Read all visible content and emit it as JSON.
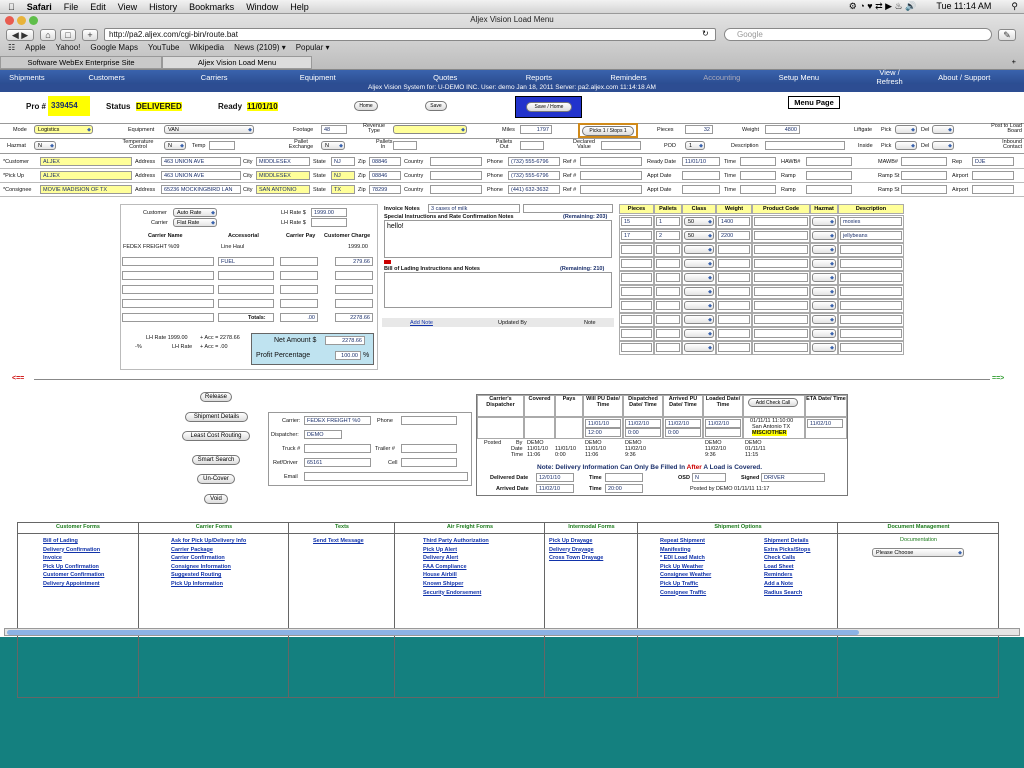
{
  "menubar": {
    "app": "Safari",
    "items": [
      "File",
      "Edit",
      "View",
      "History",
      "Bookmarks",
      "Window",
      "Help"
    ],
    "clock": "Tue 11:14 AM"
  },
  "window": {
    "title": "Aljex Vision Load Menu",
    "url": "http://pa2.aljex.com/cgi-bin/route.bat",
    "search_placeholder": "Google"
  },
  "bookmarks": [
    "Apple",
    "Yahoo!",
    "Google Maps",
    "YouTube",
    "Wikipedia",
    "News (2109) ▾",
    "Popular ▾"
  ],
  "tabs": [
    "Software WebEx Enterprise Site",
    "Aljex Vision Load Menu"
  ],
  "nav": [
    "Shipments",
    "Customers",
    "Carriers",
    "Equipment",
    "Quotes",
    "Reports",
    "Reminders",
    "Accounting",
    "Setup Menu",
    "View / Refresh",
    "About / Support"
  ],
  "system_line": "Aljex Vision System for:  U-DEMO INC.   User: demo   Jan 18, 2011   Server: pa2.aljex.com   11:14:18 AM",
  "header": {
    "pro_label": "Pro #",
    "pro": "339454",
    "status_label": "Status",
    "status": "DELIVERED",
    "ready_label": "Ready",
    "ready": "11/01/10",
    "home": "Home",
    "save": "Save",
    "save_home": "Save / Home",
    "menu_page": "Menu Page"
  },
  "row1": {
    "mode_l": "Mode",
    "mode": "Logistics",
    "equip_l": "Equipment",
    "equip": "VAN",
    "foot_l": "Footage",
    "foot": "48",
    "rev_l": "Revenue Type",
    "miles_l": "Miles",
    "miles": "1797",
    "picks": "Picks 1 / Stops 1",
    "pieces_l": "Pieces",
    "pieces": "32",
    "weight_l": "Weight",
    "weight": "4800",
    "lift_l": "Liftgate",
    "pick_l": "Pick",
    "del_l": "Del",
    "post_l": "Post to Load Board"
  },
  "row2": {
    "haz_l": "Hazmat",
    "haz": "N",
    "temp_l": "Temperature Control",
    "temp_sel": "N",
    "temp2": "Temp",
    "pallet_l": "Pallet Exchange",
    "pallet": "N",
    "pin_l": "Pallets In",
    "pout_l": "Pallets Out",
    "dval_l": "Declared Value",
    "pod_l": "POD",
    "pod": "1",
    "desc_l": "Description",
    "inside_l": "Inside",
    "pick_l": "Pick",
    "del_l": "Del",
    "inb_l": "Inbound Contact"
  },
  "parties": [
    {
      "label": "*Customer",
      "name": "ALJEX",
      "addr": "463 UNION AVE",
      "city": "MIDDLESEX",
      "state": "NJ",
      "zip": "08846",
      "phone": "(732) 555-6796",
      "datel": "Ready Date",
      "date": "11/01/10",
      "hawb": "HAWB#",
      "mawb": "MAWB#",
      "rep": "Rep",
      "repv": "DJE"
    },
    {
      "label": "*Pick Up",
      "name": "ALJEX",
      "addr": "463 UNION AVE",
      "city": "MIDDLESEX",
      "state": "NJ",
      "zip": "08846",
      "phone": "(732) 555-6796",
      "datel": "Appt Date",
      "date": "",
      "hawb": "Ramp",
      "mawb": "Ramp St",
      "rep": "Airport",
      "repv": ""
    },
    {
      "label": "*Consignee",
      "name": "MOVIE MADISION OF TX",
      "addr": "65236 MOCKINGBIRD LAN",
      "city": "SAN ANTONIO",
      "state": "TX",
      "zip": "78299",
      "phone": "(441) 632-3632",
      "datel": "Appt Date",
      "date": "",
      "hawb": "Ramp",
      "mawb": "Ramp St",
      "rep": "Airport",
      "repv": ""
    }
  ],
  "party_labels": {
    "address": "Address",
    "city": "City",
    "state": "State",
    "zip": "Zip",
    "country": "Country",
    "phone": "Phone",
    "ref": "Ref #",
    "time": "Time"
  },
  "rates": {
    "cust_l": "Customer",
    "cust": "Auto Rate",
    "carr_l": "Carrier",
    "carr": "Flat Rate",
    "lh1_l": "LH Rate $",
    "lh1": "1999.00",
    "lh2_l": "LH Rate $",
    "h_carrier": "Carrier Name",
    "h_acc": "Accessorial",
    "h_cpay": "Carrier Pay",
    "h_ccharge": "Customer Charge",
    "carrier": "FEDEX FREIGHT %09",
    "linehaul": "Line Haul",
    "lh_charge": "1999.00",
    "fuel": "FUEL",
    "fuel_charge": "279.66",
    "totals_l": "Totals:",
    "tot_pay": ".00",
    "tot_charge": "2278.66",
    "calc1a": "LH Rate 1999.00",
    "calc1b": "+ Acc = 2278.66",
    "calc2a": "-%",
    "calc2b": "LH Rate",
    "calc2c": "+ Acc = .00",
    "net_l": "Net Amount  $",
    "net": "2278.66",
    "profit_l": "Profit Percentage",
    "profit": "100.00",
    "pct": "%"
  },
  "notes": {
    "inv_l": "Invoice Notes",
    "inv": "3 cases of milk",
    "spec_l": "Special Instructions and Rate Confirmation Notes",
    "spec_rem": "(Remaining: 203)",
    "spec": "hello!",
    "bol_l": "Bill of Lading Instructions and Notes",
    "bol_rem": "(Remaining: 210)",
    "add": "Add Note",
    "upd": "Updated By",
    "note": "Note"
  },
  "pieces": {
    "headers": [
      "Pieces",
      "Pallets",
      "Class",
      "Weight",
      "Product Code",
      "Hazmat",
      "Description"
    ],
    "rows": [
      [
        "15",
        "1",
        "50",
        "1400",
        "",
        "",
        "moxies"
      ],
      [
        "17",
        "2",
        "50",
        "2200",
        "",
        "",
        "jellybeans"
      ]
    ]
  },
  "arrows": {
    "left": "<==",
    "right": "==>"
  },
  "actions": [
    "Release",
    "Shipment Details",
    "Least Cost Routing",
    "Smart Search",
    "Un-Cover",
    "Void"
  ],
  "carrier": {
    "carrier_l": "Carrier:",
    "carrier": "FEDEX FREIGHT %0",
    "phone_l": "Phone",
    "disp_l": "Dispatcher:",
    "disp": "DEMO",
    "truck_l": "Truck #",
    "trailer_l": "Trailer #",
    "ref_l": "Ref/Driver",
    "ref": "65161",
    "cell_l": "Cell",
    "email_l": "Email"
  },
  "status": {
    "h_disp": "Carrier's Dispatcher",
    "h_cov": "Covered",
    "h_pays": "Pays",
    "h_will": "Will PU Date/ Time",
    "h_dispd": "Dispatched Date/ Time",
    "h_arr": "Arrived PU Date/ Time",
    "h_load": "Loaded Date/ Time",
    "h_check": "Add Check Call",
    "h_eta": "ETA Date/ Time",
    "will_d": "11/01/10",
    "will_t": "12:00",
    "dispd_d": "11/02/10",
    "dispd_t": "0:00",
    "arr_d": "11/02/10",
    "arr_t": "0:00",
    "load_d": "11/02/10",
    "check": "01/11/11 11:10:00",
    "check2": "San Antonio TX",
    "check3": "MISC/OTHER",
    "eta": "11/02/10",
    "posted_l": "Posted",
    "by_l": "By",
    "date_l": "Date",
    "time_l": "Time",
    "p1": "DEMO",
    "p1d": "11/01/10",
    "p1t": "11:06",
    "p2": "11/01/10",
    "p2t": "0:00",
    "p3": "DEMO",
    "p3d": "11/01/10",
    "p3t": "11:06",
    "p4": "DEMO",
    "p4d": "11/02/10",
    "p4t": "9:36",
    "p5": "DEMO",
    "p5d": "11/02/10",
    "p5t": "9:36",
    "p6": "DEMO",
    "p6d": "01/11/11",
    "p6t": "11:15",
    "note_pre": "Note:  Delivery Information Can Only Be Filled In",
    "note_after": "After",
    "note_post": "A Load is Covered.",
    "deld_l": "Delivered Date",
    "deld": "12/01/10",
    "time1_l": "Time",
    "osd_l": "OSD",
    "osd": "N",
    "signed_l": "Signed By",
    "signed": "DRIVER",
    "arrd_l": "Arrived Date",
    "arrd": "11/02/10",
    "time2_l": "Time",
    "time2": "20:00",
    "postby": "Posted by DEMO   01/11/11   11:17"
  },
  "forms": {
    "cols": [
      {
        "title": "Customer Forms",
        "links": [
          "Bill of Lading",
          "Delivery Confirmation",
          "Invoice",
          "Pick Up Confirmation",
          "Customer Confirmation",
          "Delivery Appointment"
        ]
      },
      {
        "title": "Carrier Forms",
        "links": [
          "Ask for Pick Up/Delivery Info",
          "Carrier Package",
          "Carrier Confirmation",
          "Consignee Information",
          "Suggested Routing",
          "Pick Up Information"
        ]
      },
      {
        "title": "Texts",
        "links": [
          "Send Text Message"
        ]
      },
      {
        "title": "Air Freight Forms",
        "links": [
          "Third Party Authorization",
          "Pick Up Alert",
          "Delivery Alert",
          "FAA Compliance",
          "House Airbill",
          "Known Shipper",
          "Security Endorsement"
        ]
      },
      {
        "title": "Intermodal Forms",
        "links": [
          "Pick Up Drayage",
          "Delivery Drayage",
          "Cross Town Drayage"
        ]
      },
      {
        "title": "Shipment Options",
        "links": [
          "Repeat Shipment",
          "Manifesting",
          "* EDI Load Match",
          "Pick Up Weather",
          "Consignee Weather",
          "Pick Up Traffic",
          "Consignee Traffic"
        ],
        "links2": [
          "Shipment Details",
          "Extra Picks/Stops",
          "Check Calls",
          "Load Sheet",
          "Reminders",
          "Add a Note",
          "Radius Search"
        ]
      },
      {
        "title": "Document Management",
        "sub": "Documentation",
        "choose": "Please Choose"
      }
    ]
  },
  "colors": {
    "nav": "#2b4d91",
    "header_yellow": "#ffff99",
    "link": "#1133aa",
    "desktop": "#14807f"
  }
}
